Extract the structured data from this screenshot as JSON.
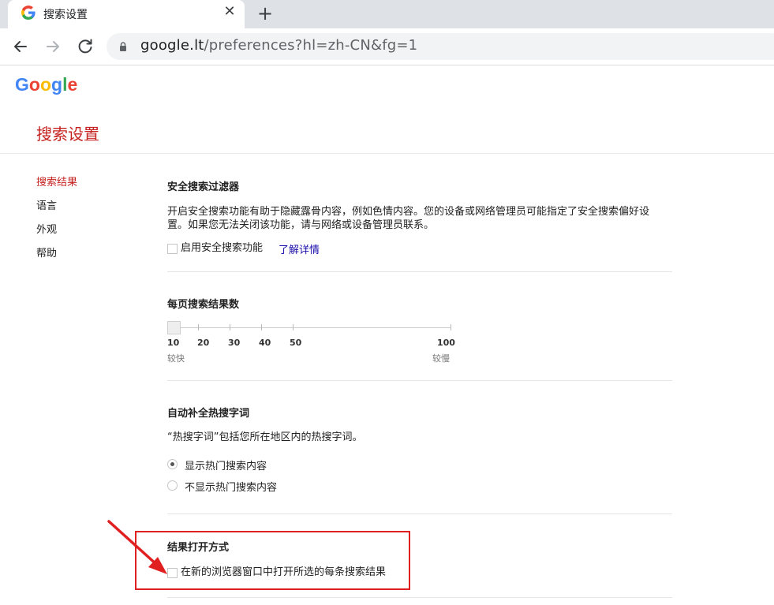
{
  "browser": {
    "tab_title": "搜索设置",
    "new_tab_symbol": "+",
    "close_symbol": "✕",
    "url_host": "google.lt",
    "url_path": "/preferences?hl=zh-CN&fg=1"
  },
  "logo": {
    "letters": [
      "G",
      "o",
      "o",
      "g",
      "l",
      "e"
    ],
    "colors": [
      "#4285f4",
      "#ea4335",
      "#fbbc05",
      "#4285f4",
      "#34a853",
      "#ea4335"
    ]
  },
  "page": {
    "title": "搜索设置"
  },
  "sidenav": {
    "items": [
      "搜索结果",
      "语言",
      "外观",
      "帮助"
    ]
  },
  "safe_search": {
    "title": "安全搜索过滤器",
    "desc_line1": "开启安全搜索功能有助于隐藏露骨内容，例如色情内容。您的设备或网络管理员可能指定了安全搜索偏好设",
    "desc_line2": "置。如果您无法关闭该功能，请与网络或设备管理员联系。",
    "checkbox_label": "启用安全搜索功能",
    "checked": false,
    "learn_more": "了解详情"
  },
  "results_per_page": {
    "title": "每页搜索结果数",
    "ticks": [
      "10",
      "20",
      "30",
      "40",
      "50",
      "100"
    ],
    "value": 10,
    "faster_label": "较快",
    "slower_label": "较慢"
  },
  "autocomplete": {
    "title": "自动补全热搜字词",
    "desc": "“热搜字词”包括您所在地区内的热搜字词。",
    "options": [
      "显示热门搜索内容",
      "不显示热门搜索内容"
    ],
    "selected_index": 0
  },
  "open_results": {
    "title": "结果打开方式",
    "checkbox_label": "在新的浏览器窗口中打开所选的每条搜索结果",
    "checked": false
  },
  "colors": {
    "accent": "#c5221f",
    "link": "#1a0dab",
    "annotation": "#e02020"
  }
}
